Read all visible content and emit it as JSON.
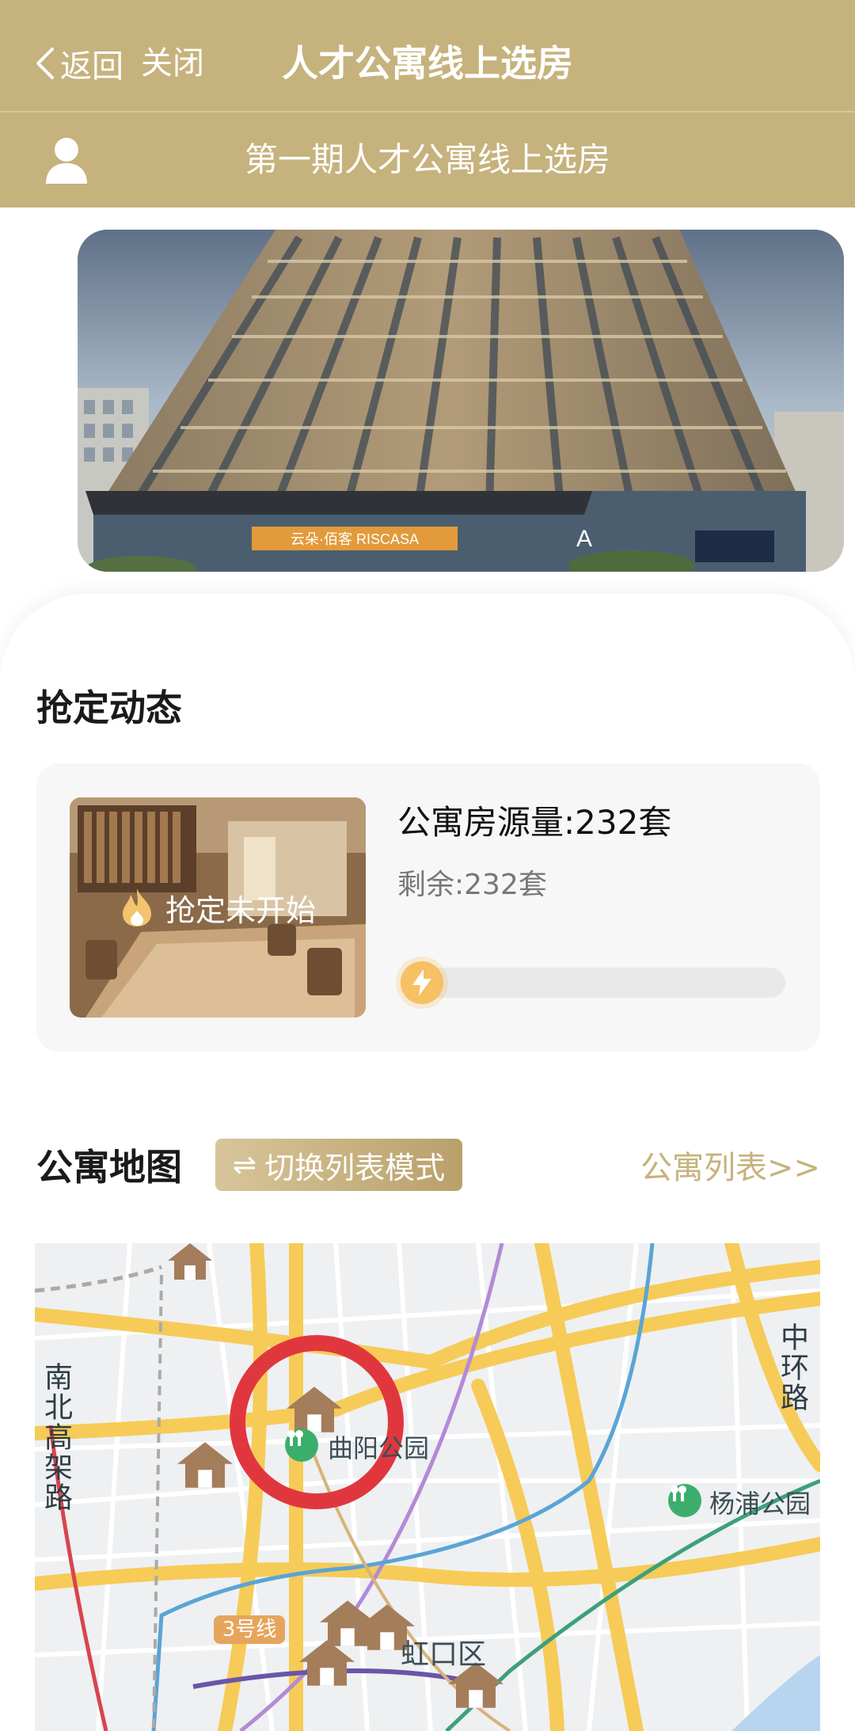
{
  "nav": {
    "back_label": "返回",
    "close_label": "关闭",
    "title": "人才公寓线上选房"
  },
  "subheader": {
    "title": "第一期人才公寓线上选房",
    "user_icon": "user-icon"
  },
  "banner": {
    "sign_text": "云朵·佰客 RISCASA",
    "building_letter": "A"
  },
  "rush": {
    "section_title": "抢定动态",
    "status_text": "抢定未开始",
    "status_icon": "flame-icon",
    "total_text": "公寓房源量:232套",
    "remaining_text": "剩余:232套",
    "progress_fraction": 0.0,
    "accent_color": "#f1b04c"
  },
  "map_section": {
    "section_title": "公寓地图",
    "switch_icon": "⇌",
    "switch_label": "切换列表模式",
    "list_link": "公寓列表>>",
    "labels": {
      "park_quyang": "曲阳公园",
      "park_yangpu": "杨浦公园",
      "district": "虹口区",
      "road_left": "南北高架路",
      "road_right": "中环路",
      "metro_line": "3号线"
    }
  },
  "colors": {
    "brand": "#c6b27d",
    "highlight_circle": "#e0373f",
    "house_marker": "#a47d5b"
  }
}
